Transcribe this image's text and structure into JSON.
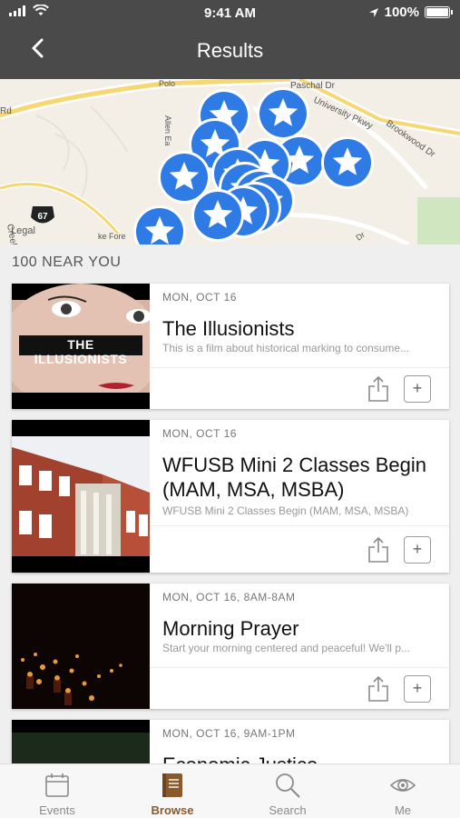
{
  "status_bar": {
    "time": "9:41 AM",
    "battery": "100%"
  },
  "nav": {
    "title": "Results"
  },
  "map": {
    "streets": [
      "Paschal Dr",
      "University Pkwy",
      "Brookwood Dr",
      "Allen Ea",
      "Polo",
      "Rd",
      "Creek",
      "Dr",
      "ke Fore"
    ],
    "route_marker": "67",
    "legal": "Legal",
    "pin_color": "#2f7be5"
  },
  "section": {
    "heading": "100 NEAR YOU"
  },
  "events": [
    {
      "date": "MON, OCT 16",
      "title": "The Illusionists",
      "desc": "This is a film about historical marking to consume...",
      "thumb_caption": "THE ILLUSIONISTS"
    },
    {
      "date": "MON, OCT 16",
      "title": "WFUSB Mini 2 Classes Begin (MAM, MSA, MSBA)",
      "desc": "WFUSB Mini 2 Classes Begin (MAM, MSA, MSBA)"
    },
    {
      "date": "MON, OCT 16, 8AM-8AM",
      "title": "Morning Prayer",
      "desc": "Start your morning centered and peaceful! We'll p..."
    },
    {
      "date": "MON, OCT 16, 9AM-1PM",
      "title": "Economic Justice"
    }
  ],
  "tabs": [
    {
      "label": "Events",
      "icon": "calendar-icon"
    },
    {
      "label": "Browse",
      "icon": "book-icon",
      "active": true
    },
    {
      "label": "Search",
      "icon": "search-icon"
    },
    {
      "label": "Me",
      "icon": "eye-icon"
    }
  ],
  "colors": {
    "nav_bg": "#4a4a4a",
    "accent": "#8b5a2b",
    "pin": "#2f7be5"
  }
}
